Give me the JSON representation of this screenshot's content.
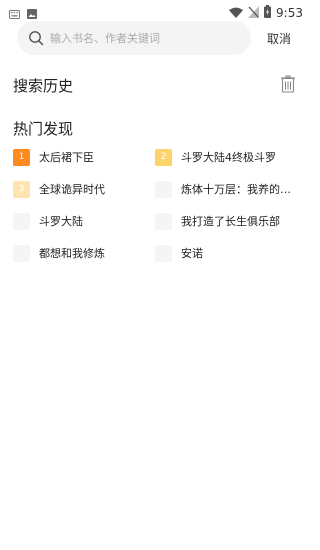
{
  "status_bar": {
    "time": "9:53",
    "left_icons": [
      "keyboard-icon",
      "image-icon"
    ],
    "right_icons": [
      "wifi-icon",
      "no-signal-icon",
      "battery-charging-icon"
    ]
  },
  "search": {
    "placeholder": "输入书名、作者关键词",
    "value": "",
    "cancel_label": "取消"
  },
  "history": {
    "title": "搜索历史"
  },
  "hot": {
    "title": "热门发现",
    "items": [
      {
        "rank": "1",
        "title": "太后裙下臣",
        "badge_color": "#ff8a1f"
      },
      {
        "rank": "2",
        "title": "斗罗大陆4终极斗罗",
        "badge_color": "#ffd36b"
      },
      {
        "rank": "3",
        "title": "全球诡异时代",
        "badge_color": "#ffe3b0"
      },
      {
        "rank": "4",
        "title": "炼体十万层：我养的…",
        "badge_color": "#f5f5f5"
      },
      {
        "rank": "5",
        "title": "斗罗大陆",
        "badge_color": "#f5f5f5"
      },
      {
        "rank": "6",
        "title": "我打造了长生俱乐部",
        "badge_color": "#f5f5f5"
      },
      {
        "rank": "7",
        "title": "都想和我修炼",
        "badge_color": "#f5f5f5"
      },
      {
        "rank": "8",
        "title": "安诺",
        "badge_color": "#f5f5f5"
      }
    ]
  }
}
